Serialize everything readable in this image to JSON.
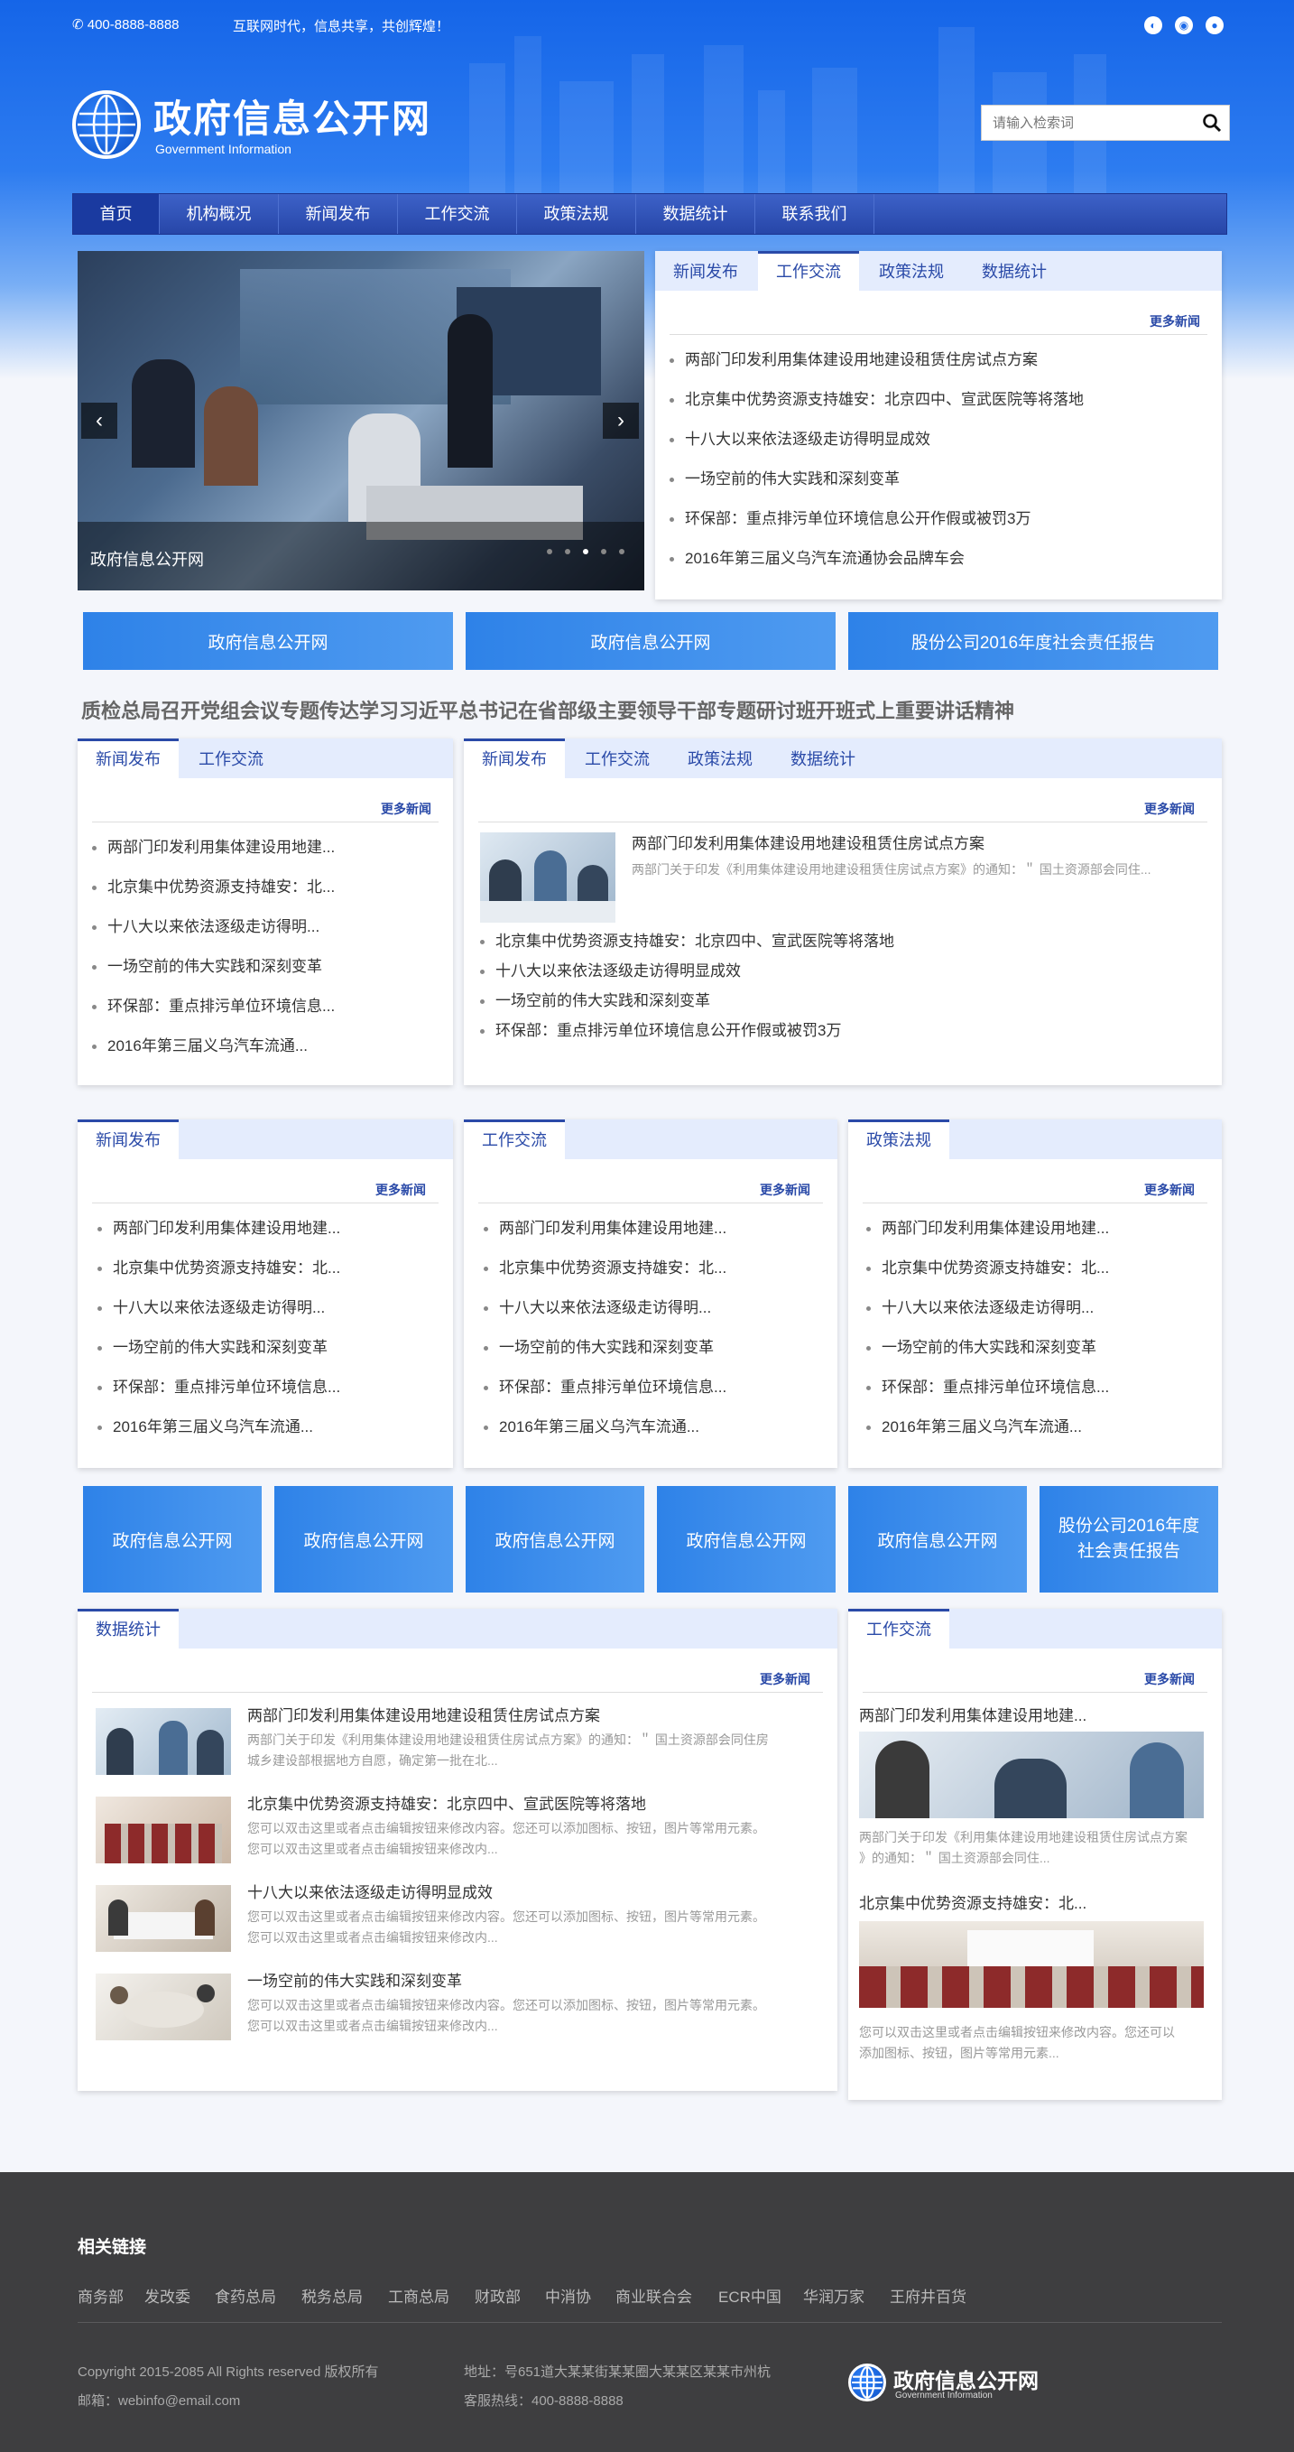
{
  "topbar": {
    "phone": "400-8888-8888",
    "slogan": "互联网时代，信息共享，共创辉煌！"
  },
  "logo": {
    "title": "政府信息公开网",
    "subtitle": "Government Information"
  },
  "search": {
    "placeholder": "请输入检索词"
  },
  "nav": [
    "首页",
    "机构概况",
    "新闻发布",
    "工作交流",
    "政策法规",
    "数据统计",
    "联系我们"
  ],
  "slider": {
    "caption": "政府信息公开网"
  },
  "tabs_main": [
    "新闻发布",
    "工作交流",
    "政策法规",
    "数据统计"
  ],
  "tabs_two": [
    "新闻发布",
    "工作交流"
  ],
  "more": "更多新闻",
  "news_full": [
    "两部门印发利用集体建设用地建设租赁住房试点方案",
    "北京集中优势资源支持雄安：北京四中、宣武医院等将落地",
    "十八大以来依法逐级走访得明显成效",
    "一场空前的伟大实践和深刻变革",
    "环保部：重点排污单位环境信息公开作假或被罚3万",
    "2016年第三届义乌汽车流通协会品牌车会"
  ],
  "news_short": [
    "两部门印发利用集体建设用地建...",
    "北京集中优势资源支持雄安：北...",
    "十八大以来依法逐级走访得明...",
    "一场空前的伟大实践和深刻变革",
    "环保部：重点排污单位环境信息...",
    "2016年第三届义乌汽车流通..."
  ],
  "banners3": [
    "政府信息公开网",
    "政府信息公开网",
    "股份公司2016年度社会责任报告"
  ],
  "headline": "质检总局召开党组会议专题传达学习习近平总书记在省部级主要领导干部专题研讨班开班式上重要讲话精神",
  "feature": {
    "title": "两部门印发利用集体建设用地建设租赁住房试点方案",
    "desc": "两部门关于印发《利用集体建设用地建设租赁住房试点方案》的通知：＂ 国土资源部会同住..."
  },
  "feature_list": [
    "北京集中优势资源支持雄安：北京四中、宣武医院等将落地",
    "十八大以来依法逐级走访得明显成效",
    "一场空前的伟大实践和深刻变革",
    "环保部：重点排污单位环境信息公开作假或被罚3万"
  ],
  "col_tabs": [
    "新闻发布",
    "工作交流",
    "政策法规"
  ],
  "banners6": [
    "政府信息公开网",
    "政府信息公开网",
    "政府信息公开网",
    "政府信息公开网",
    "政府信息公开网",
    "股份公司2016年度社会责任报告"
  ],
  "stats": {
    "tab": "数据统计",
    "items": [
      {
        "title": "两部门印发利用集体建设用地建设租赁住房试点方案",
        "desc1": "两部门关于印发《利用集体建设用地建设租赁住房试点方案》的通知：＂ 国土资源部会同住房",
        "desc2": "城乡建设部根据地方自愿，确定第一批在北..."
      },
      {
        "title": "北京集中优势资源支持雄安：北京四中、宣武医院等将落地",
        "desc1": "您可以双击这里或者点击编辑按钮来修改内容。您还可以添加图标、按钮，图片等常用元素。",
        "desc2": "您可以双击这里或者点击编辑按钮来修改内..."
      },
      {
        "title": "十八大以来依法逐级走访得明显成效",
        "desc1": "您可以双击这里或者点击编辑按钮来修改内容。您还可以添加图标、按钮，图片等常用元素。",
        "desc2": "您可以双击这里或者点击编辑按钮来修改内..."
      },
      {
        "title": "一场空前的伟大实践和深刻变革",
        "desc1": "您可以双击这里或者点击编辑按钮来修改内容。您还可以添加图标、按钮，图片等常用元素。",
        "desc2": "您可以双击这里或者点击编辑按钮来修改内..."
      }
    ]
  },
  "work": {
    "tab": "工作交流",
    "t1": "两部门印发利用集体建设用地建...",
    "d1a": "两部门关于印发《利用集体建设用地建设租赁住房试点方案",
    "d1b": "》的通知：＂ 国土资源部会同住...",
    "t2": "北京集中优势资源支持雄安：北...",
    "d2a": "您可以双击这里或者点击编辑按钮来修改内容。您还可以",
    "d2b": "添加图标、按钮，图片等常用元素..."
  },
  "footer": {
    "links_title": "相关链接",
    "links": [
      "商务部",
      "发改委",
      "食药总局",
      "税务总局",
      "工商总局",
      "财政部",
      "中消协",
      "商业联合会",
      "ECR中国",
      "华润万家",
      "王府井百货"
    ],
    "copyright": "Copyright 2015-2085 All Rights reserved 版权所有",
    "email": "邮箱：webinfo@email.com",
    "address": "地址：号651道大某某街某某圈大某某区某某市州杭",
    "hotline": "客服热线：400-8888-8888",
    "logo_title": "政府信息公开网",
    "logo_sub": "Government Information"
  }
}
